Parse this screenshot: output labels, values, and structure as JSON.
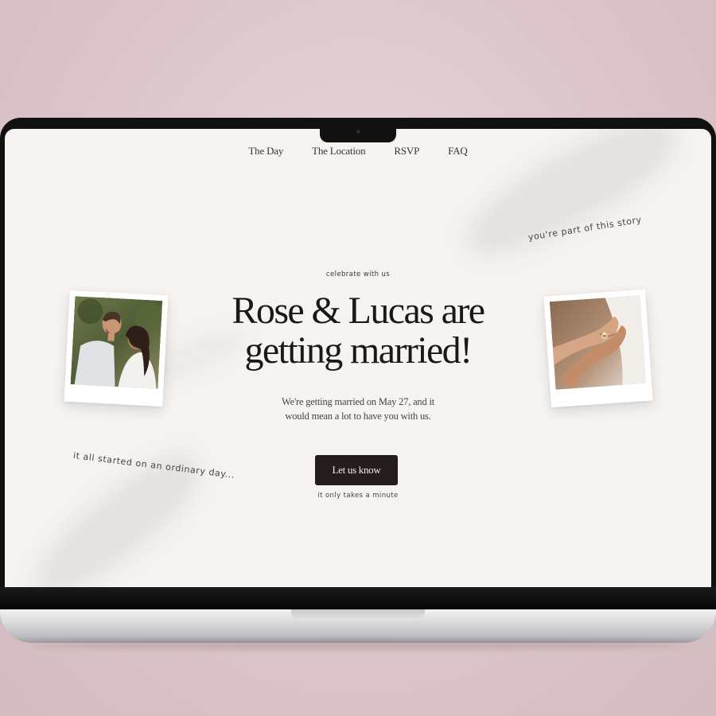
{
  "nav": {
    "items": [
      "The Day",
      "The Location",
      "RSVP",
      "FAQ"
    ]
  },
  "hero": {
    "eyebrow": "celebrate with us",
    "headline_line1": "Rose & Lucas are",
    "headline_line2": "getting married!",
    "subtext": "We're getting married on May 27, and it would mean a lot to have you with us.",
    "cta_label": "Let us know",
    "cta_note": "it only takes a minute"
  },
  "notes": {
    "left": "it all started on an ordinary day...",
    "right": "you're part of this story"
  },
  "colors": {
    "page_background": "#dcc6ca",
    "screen_background": "#f6f3f0",
    "text_dark": "#1c1816",
    "button_background": "#231d1b",
    "button_text": "#f2ede9"
  },
  "photos": {
    "left": "couple-photo",
    "right": "ring-hands-photo"
  }
}
